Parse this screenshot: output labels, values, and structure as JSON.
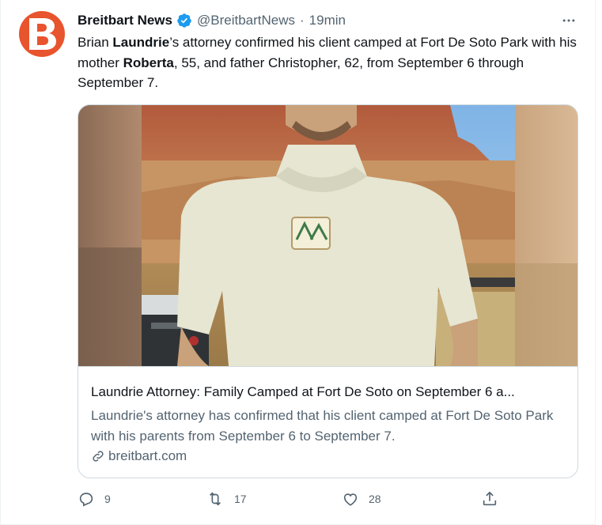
{
  "tweet": {
    "author_name": "Breitbart News",
    "author_handle": "@BreitbartNews",
    "separator": "·",
    "time": "19min",
    "text_parts": [
      {
        "t": "Brian ",
        "bold": false
      },
      {
        "t": "Laundrie",
        "bold": true
      },
      {
        "t": "’s attorney confirmed his client camped at Fort De Soto Park with his mother ",
        "bold": false
      },
      {
        "t": "Roberta",
        "bold": true
      },
      {
        "t": ", 55, and father Christopher, 62, from September 6 through September 7.",
        "bold": false
      }
    ]
  },
  "card": {
    "title": "Laundrie Attorney: Family Camped at Fort De Soto on September 6 a...",
    "description": "Laundrie's attorney has confirmed that his client camped at Fort De Soto Park with his parents from September 6 to September 7.",
    "domain": "breitbart.com"
  },
  "actions": {
    "reply_count": "9",
    "retweet_count": "17",
    "like_count": "28"
  },
  "colors": {
    "brand": "#e8542d",
    "verified": "#1d9bf0",
    "secondary_text": "#536471",
    "border": "#cfd9de"
  },
  "icons": [
    "breitbart-logo-icon",
    "verified-badge-icon",
    "more-icon",
    "link-icon",
    "reply-icon",
    "retweet-icon",
    "like-icon",
    "share-icon"
  ]
}
